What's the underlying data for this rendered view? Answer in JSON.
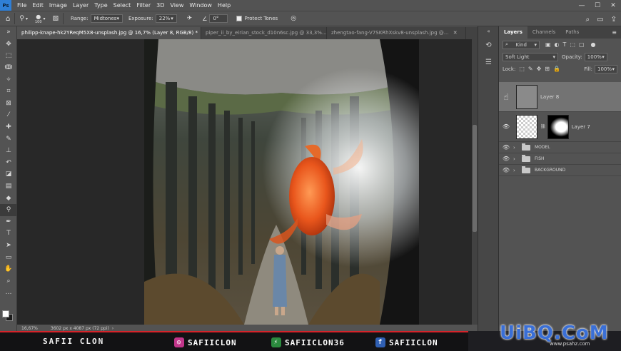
{
  "app": {
    "logo": "Ps"
  },
  "menu": [
    "File",
    "Edit",
    "Image",
    "Layer",
    "Type",
    "Select",
    "Filter",
    "3D",
    "View",
    "Window",
    "Help"
  ],
  "window_controls": {
    "minimize": "—",
    "maximize": "☐",
    "close": "✕"
  },
  "options": {
    "brush_size": "100",
    "range_label": "Range:",
    "range_value": "Midtones",
    "exposure_label": "Exposure:",
    "exposure_value": "22%",
    "angle_value": "0°",
    "protect_tones_label": "Protect Tones"
  },
  "tabs": [
    {
      "label": "philipp-knape-hk2YReqM5X8-unsplash.jpg @ 16,7% (Layer 8, RGB/8) *",
      "active": true
    },
    {
      "label": "piper_ii_by_eirian_stock_d10n6sc.jpg @ 33,3%...",
      "active": false
    },
    {
      "label": "zhengtao-fang-V7SKRhXskv8-unsplash.jpg @...",
      "active": false
    }
  ],
  "status": {
    "zoom": "16,67%",
    "doc_info": "3602 px x 4087 px (72 ppi)"
  },
  "layers_panel": {
    "tabs": [
      "Layers",
      "Channels",
      "Paths"
    ],
    "kind_label": "Kind",
    "blend_mode": "Soft Light",
    "opacity_label": "Opacity:",
    "opacity_value": "100%",
    "lock_label": "Lock:",
    "fill_label": "Fill:",
    "fill_value": "100%",
    "layers": [
      {
        "name": "Layer 8",
        "selected": true
      },
      {
        "name": "Layer 7",
        "selected": false
      }
    ],
    "groups": [
      "MODEL",
      "FISH",
      "BACKGROUND"
    ]
  },
  "banner": {
    "name": "SAFII CLON",
    "instagram": "SAFIICLON",
    "gimp_like": "SAFIICLON36",
    "facebook": "SAFIICLON",
    "accent": "#d6232a"
  },
  "watermark": {
    "main": "UiBQ.CoM",
    "sub": "www.psahz.com"
  }
}
